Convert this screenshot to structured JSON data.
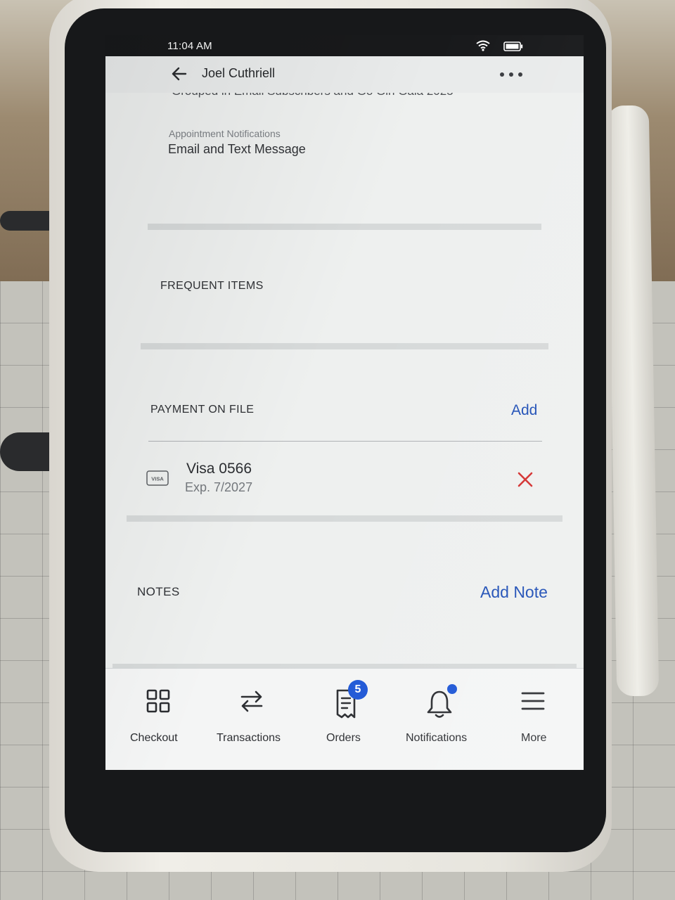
{
  "status_bar": {
    "time": "11:04 AM"
  },
  "header": {
    "title": "Joel Cuthriell"
  },
  "customer": {
    "groups_line": "Grouped in Email Subscribers and Go Girl Gala 2025",
    "appointment_label": "Appointment Notifications",
    "appointment_value": "Email and Text Message"
  },
  "frequent_items": {
    "heading": "FREQUENT ITEMS"
  },
  "payment": {
    "heading": "PAYMENT ON FILE",
    "add_label": "Add",
    "card": {
      "brand_mark": "VISA",
      "title": "Visa 0566",
      "expiry": "Exp. 7/2027"
    }
  },
  "notes": {
    "heading": "NOTES",
    "add_label": "Add Note"
  },
  "bottom_nav": {
    "items": [
      {
        "label": "Checkout",
        "icon": "grid-icon"
      },
      {
        "label": "Transactions",
        "icon": "arrows-swap-icon"
      },
      {
        "label": "Orders",
        "icon": "receipt-icon",
        "badge": "5"
      },
      {
        "label": "Notifications",
        "icon": "bell-icon",
        "has_dot": true
      },
      {
        "label": "More",
        "icon": "hamburger-icon"
      }
    ]
  },
  "colors": {
    "accent": "#1f4fb6",
    "badge": "#1d56d6",
    "remove": "#d32f2f"
  }
}
